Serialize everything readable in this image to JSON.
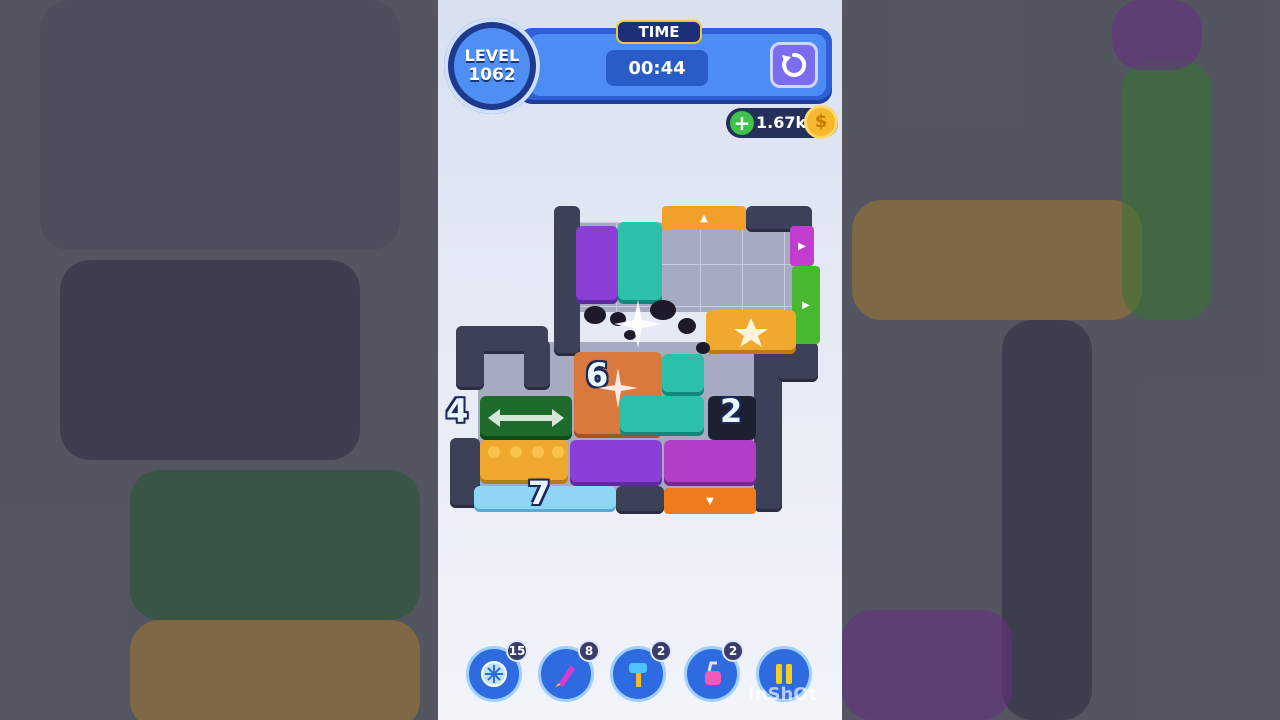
{
  "hud": {
    "level_label": "LEVEL",
    "level_number": "1062",
    "time_label": "TIME",
    "time_value": "00:44",
    "coins": "1.67k",
    "coin_plus": "+",
    "coin_symbol": "$"
  },
  "board": {
    "counters": {
      "orange_block": "6",
      "green_block": "4",
      "dark_block": "2",
      "ice_block": "7"
    }
  },
  "boosters": [
    {
      "name": "freeze-booster",
      "count": "15"
    },
    {
      "name": "rocket-booster",
      "count": "8"
    },
    {
      "name": "hammer-booster",
      "count": "2"
    },
    {
      "name": "vacuum-booster",
      "count": "2"
    }
  ],
  "watermark": "InShOt",
  "colors": {
    "hud_blue": "#2f5fd8",
    "purple": "#8a3fd6",
    "teal": "#2ac1a8",
    "orange": "#d9793e",
    "gold": "#f0a82e",
    "green": "#1f6b2c"
  }
}
